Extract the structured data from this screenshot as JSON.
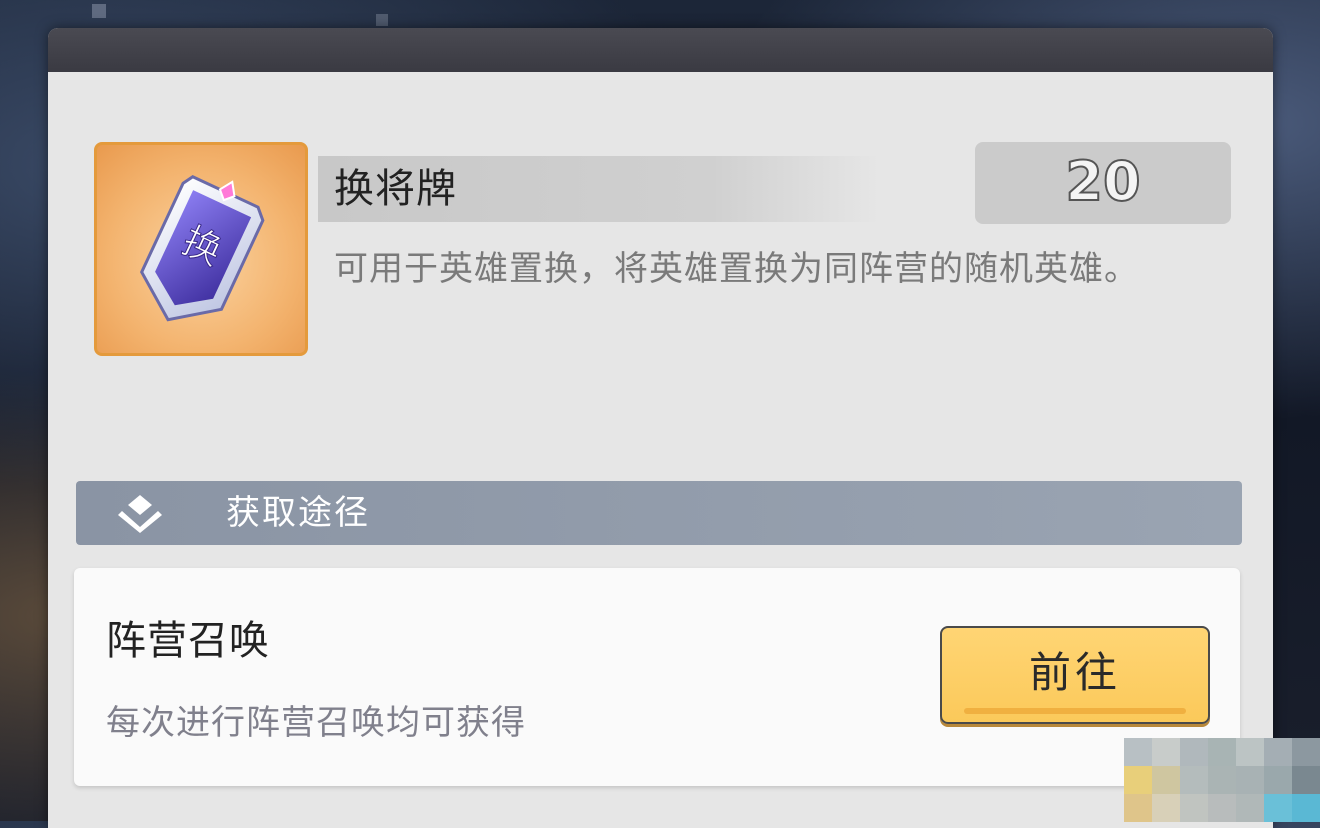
{
  "item": {
    "name": "换将牌",
    "count": "20",
    "description": "可用于英雄置换，将英雄置换为同阵营的随机英雄。",
    "icon": "hero-swap-token-icon",
    "icon_glyph": "换"
  },
  "acquire_section": {
    "title": "获取途径",
    "icon": "diamond-chevron-icon"
  },
  "sources": [
    {
      "title": "阵营召唤",
      "description": "每次进行阵营召唤均可获得",
      "button_label": "前往"
    }
  ],
  "colors": {
    "accent_button": "#fbc95a",
    "icon_frame": "#e49a3c",
    "section_bar": "#8a94a4"
  }
}
